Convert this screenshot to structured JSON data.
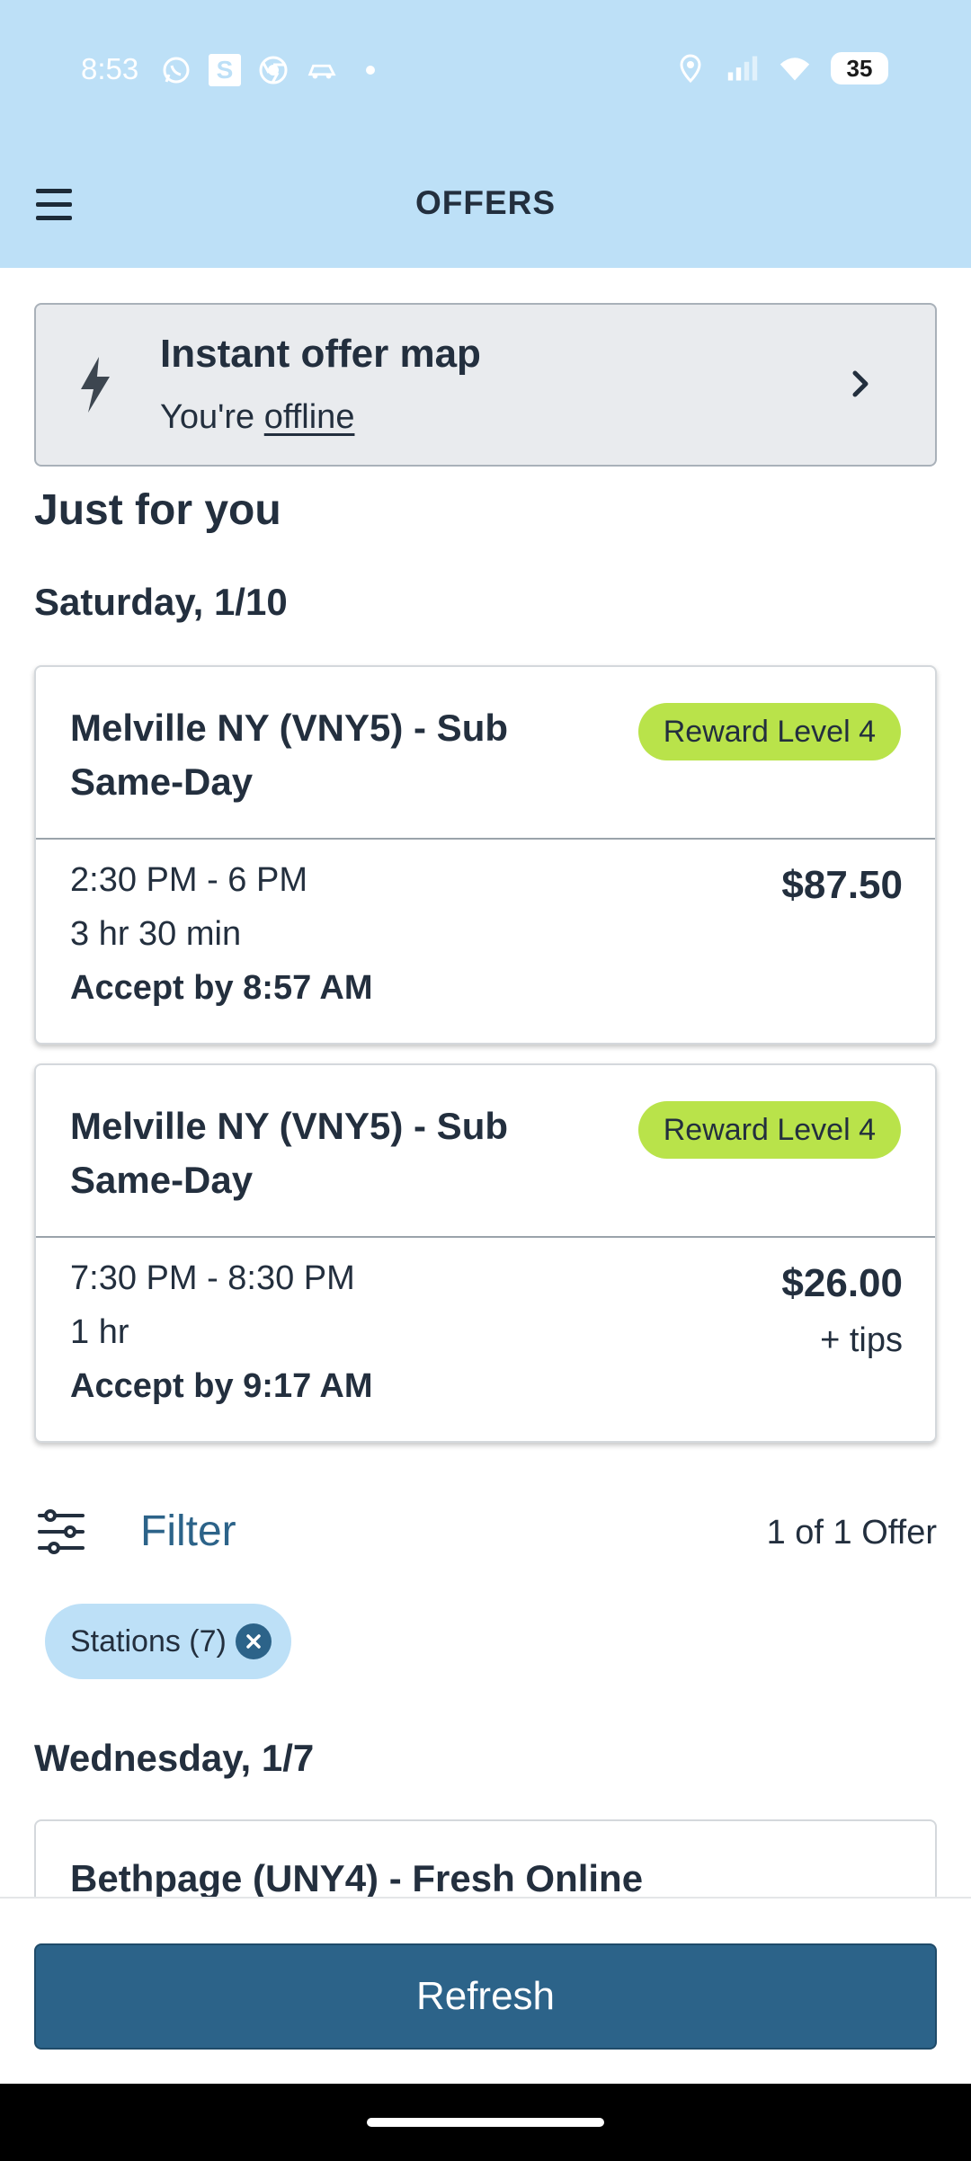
{
  "status_bar": {
    "time": "8:53",
    "left_icons": [
      "whatsapp-icon",
      "s-app-icon",
      "chrome-icon",
      "car-app-icon",
      "dot-icon"
    ],
    "s_letter": "S",
    "right_icons": [
      "location-icon",
      "signal-icon",
      "wifi-icon"
    ],
    "battery": "35"
  },
  "header": {
    "title": "OFFERS",
    "menu_icon": "hamburger-menu-icon"
  },
  "instant_offer": {
    "title": "Instant offer map",
    "status_prefix": "You're ",
    "status_link": "offline",
    "icon": "lightning-bolt-icon",
    "chevron": "chevron-right-icon"
  },
  "section_title": "Just for you",
  "groups": [
    {
      "date": "Saturday, 1/10",
      "offers": [
        {
          "location": "Melville NY (VNY5) - Sub Same-Day",
          "badge": "Reward Level 4",
          "time_range": "2:30 PM - 6 PM",
          "duration": "3 hr 30 min",
          "accept_by": "Accept by 8:57 AM",
          "price": "$87.50",
          "tips": ""
        },
        {
          "location": "Melville NY (VNY5) - Sub Same-Day",
          "badge": "Reward Level 4",
          "time_range": "7:30 PM - 8:30 PM",
          "duration": "1 hr",
          "accept_by": "Accept by 9:17 AM",
          "price": "$26.00",
          "tips": "+ tips"
        }
      ]
    }
  ],
  "filter": {
    "label": "Filter",
    "icon": "sliders-icon",
    "count": "1 of 1 Offer",
    "chips": [
      {
        "label": "Stations (7)",
        "icon": "remove-icon"
      }
    ]
  },
  "second_group": {
    "date": "Wednesday, 1/7",
    "first_offer_location": "Bethpage (UNY4) - Fresh Online"
  },
  "refresh_label": "Refresh",
  "colors": {
    "header_bg": "#bde0f7",
    "primary": "#2c6389",
    "badge": "#b9e34a",
    "text": "#232f3e"
  }
}
